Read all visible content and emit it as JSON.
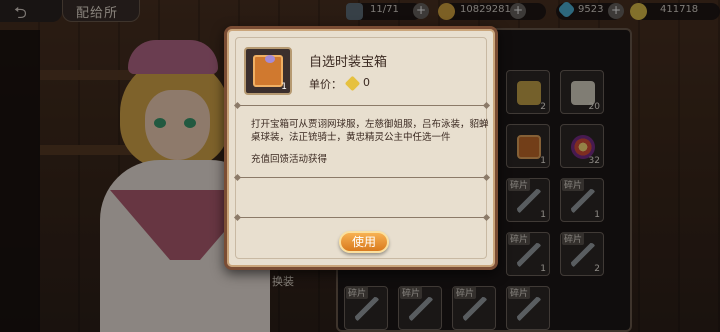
{
  "topbar": {
    "title": "配给所",
    "resources": [
      {
        "icon": "energy-icon",
        "value": "11/71",
        "color": "#5f6e7a"
      },
      {
        "icon": "gold-coin-icon",
        "value": "10829281",
        "color": "#d6a640"
      },
      {
        "icon": "blue-gem-icon",
        "value": "9523",
        "color": "#4fb4d8"
      },
      {
        "icon": "gold-ingot-icon",
        "value": "411718",
        "color": "#e1c14a"
      }
    ]
  },
  "dialog": {
    "item_name": "自选时装宝箱",
    "item_count": "1",
    "price_label": "单价：",
    "price_value": "0",
    "description": "打开宝箱可从贾诩网球服，左慈御姐服，吕布泳装，貂蝉桌球装，法正铳骑士，黄忠精灵公主中任选一件",
    "source": "充值回馈活动获得",
    "use_button": "使用"
  },
  "background": {
    "equip_label": "换装",
    "grid_cells": [
      {
        "icon": "gold-ore-icon",
        "tag": "",
        "count": "2"
      },
      {
        "icon": "white-crystal-icon",
        "tag": "",
        "count": "20"
      },
      {
        "icon": "gift-box-icon",
        "tag": "",
        "count": "1"
      },
      {
        "icon": "firework-icon",
        "tag": "",
        "count": "32"
      },
      {
        "icon": "weapon-fragment-icon",
        "tag": "碎片",
        "count": "1"
      },
      {
        "icon": "weapon-fragment-icon",
        "tag": "碎片",
        "count": "1"
      },
      {
        "icon": "weapon-fragment-icon",
        "tag": "碎片",
        "count": "1"
      },
      {
        "icon": "weapon-fragment-icon",
        "tag": "碎片",
        "count": "2"
      },
      {
        "icon": "weapon-fragment-icon",
        "tag": "碎片",
        "count": ""
      },
      {
        "icon": "weapon-fragment-icon",
        "tag": "碎片",
        "count": ""
      },
      {
        "icon": "weapon-fragment-icon",
        "tag": "碎片",
        "count": ""
      },
      {
        "icon": "weapon-fragment-icon",
        "tag": "碎片",
        "count": ""
      }
    ]
  }
}
